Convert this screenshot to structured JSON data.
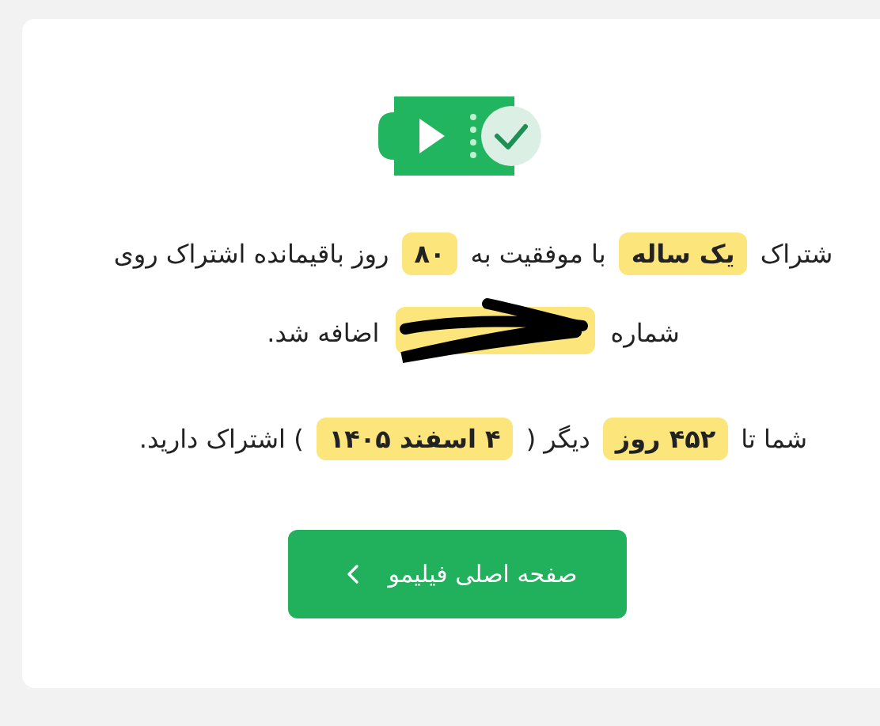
{
  "message_lines": [
    {
      "segments": [
        {
          "kind": "text",
          "text": "شتراک"
        },
        {
          "kind": "highlight",
          "text": "یک ساله"
        },
        {
          "kind": "text",
          "text": "با موفقیت به"
        },
        {
          "kind": "highlight",
          "text": "۸۰"
        },
        {
          "kind": "text",
          "text": "روز باقیمانده اشتراک روی"
        }
      ]
    },
    {
      "segments": [
        {
          "kind": "text",
          "text": "شماره"
        },
        {
          "kind": "redacted"
        },
        {
          "kind": "text",
          "text": "اضافه شد."
        }
      ]
    },
    {
      "segments": [
        {
          "kind": "text",
          "text": "شما تا"
        },
        {
          "kind": "highlight",
          "text": "۴۵۲ روز"
        },
        {
          "kind": "text",
          "text": "دیگر ("
        },
        {
          "kind": "highlight",
          "text": "۴ اسفند ۱۴۰۵"
        },
        {
          "kind": "text",
          "text": ") اشتراک دارید."
        }
      ]
    }
  ],
  "home_button": {
    "label": "صفحه اصلی فیلیمو"
  }
}
